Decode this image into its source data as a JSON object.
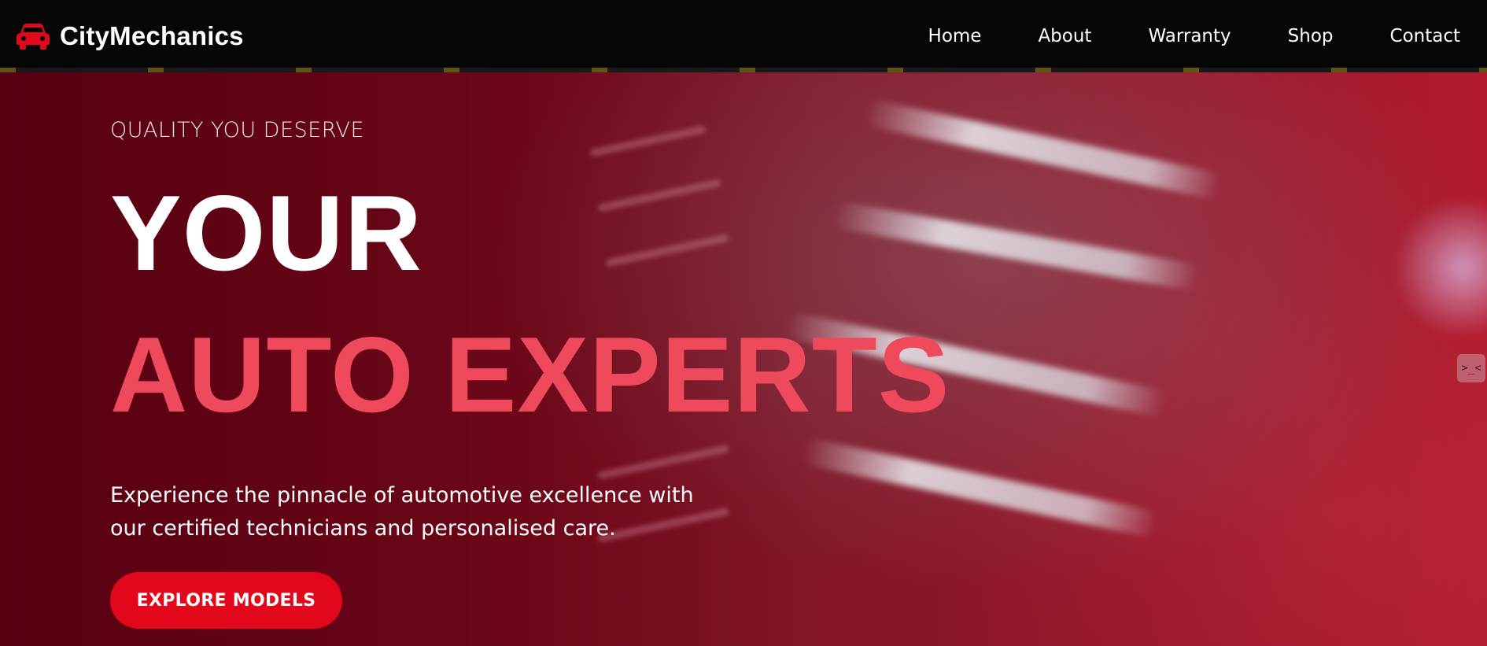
{
  "brand": {
    "name": "CityMechanics",
    "icon": "car-icon",
    "accent_color": "#e3071c"
  },
  "nav": {
    "items": [
      {
        "label": "Home"
      },
      {
        "label": "About"
      },
      {
        "label": "Warranty"
      },
      {
        "label": "Shop"
      },
      {
        "label": "Contact"
      }
    ]
  },
  "hero": {
    "eyebrow": "QUALITY YOU DESERVE",
    "headline_line1": "YOUR",
    "headline_line2": "AUTO EXPERTS",
    "headline_line2_color": "#ee4a5c",
    "description": "Experience the pinnacle of automotive excellence with our certified technicians and personalised care.",
    "cta_label": "EXPLORE MODELS"
  },
  "side_widget": {
    "icon": "chat-face-icon",
    "glyph": ">_<"
  }
}
